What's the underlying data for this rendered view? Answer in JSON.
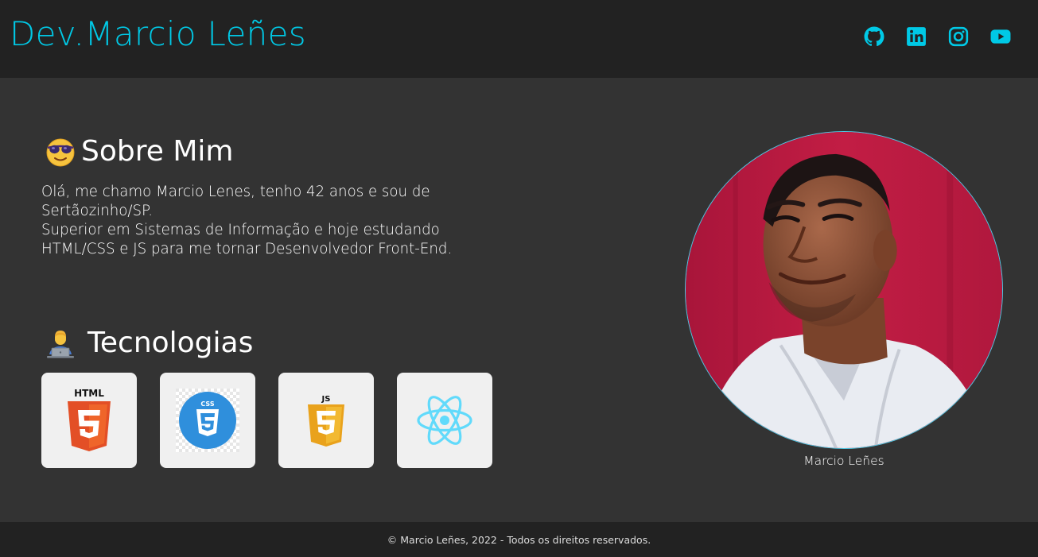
{
  "header": {
    "brand": "Dev.Marcio Leñes",
    "social": [
      {
        "name": "github",
        "icon": "github-icon"
      },
      {
        "name": "linkedin",
        "icon": "linkedin-icon"
      },
      {
        "name": "instagram",
        "icon": "instagram-icon"
      },
      {
        "name": "youtube",
        "icon": "youtube-icon"
      }
    ]
  },
  "about": {
    "emoji": "smiling-face-with-sunglasses-icon",
    "title": "Sobre Mim",
    "lines": [
      "Olá, me chamo Marcio Lenes, tenho 42 anos e sou de",
      "Sertãozinho/SP.",
      "Superior em Sistemas de Informação e hoje estudando",
      "HTML/CSS e JS para me tornar Desenvolvedor Front-End."
    ]
  },
  "tech": {
    "emoji": "technologist-icon",
    "title": "Tecnologias",
    "items": [
      {
        "name": "HTML",
        "icon": "html5-icon"
      },
      {
        "name": "CSS",
        "icon": "css3-icon"
      },
      {
        "name": "JS",
        "icon": "javascript-icon"
      },
      {
        "name": "React",
        "icon": "react-icon"
      }
    ]
  },
  "profile": {
    "caption": "Marcio Leñes"
  },
  "footer": {
    "text": "© Marcio Leñes, 2022 - Todos os direitos reservados."
  },
  "colors": {
    "accent": "#00c9e6",
    "header_bg": "#222222",
    "main_bg": "#333333",
    "card_bg": "#f0f0f0"
  }
}
